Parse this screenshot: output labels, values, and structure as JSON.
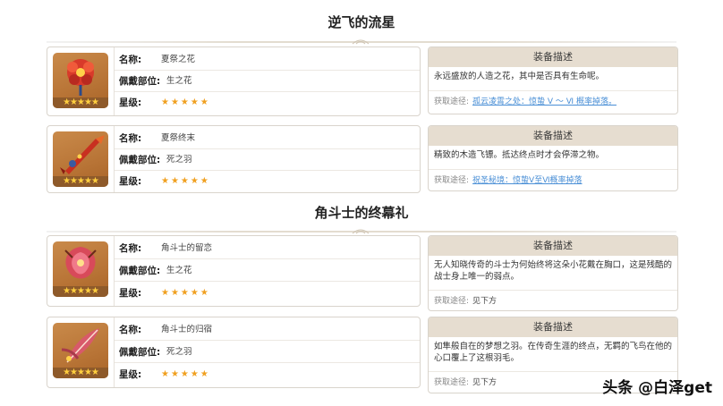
{
  "sets": [
    {
      "title": "逆飞的流星",
      "items": [
        {
          "name_label": "名称:",
          "name": "夏祭之花",
          "slot_label": "佩戴部位:",
          "slot": "生之花",
          "rarity_label": "星级:",
          "rarity": 5,
          "thumb_rarity": 5,
          "desc_header": "装备描述",
          "desc": "永远盛放的人造之花，其中是否具有生命呢。",
          "source_label": "获取途径:",
          "source": "孤云凌霄之处：惊蛰 Ⅴ ～ Ⅵ 概率掉落。",
          "source_is_link": true,
          "icon": "flower-icon"
        },
        {
          "name_label": "名称:",
          "name": "夏祭终末",
          "slot_label": "佩戴部位:",
          "slot": "死之羽",
          "rarity_label": "星级:",
          "rarity": 5,
          "thumb_rarity": 5,
          "desc_header": "装备描述",
          "desc": "精致的木造飞镖。抵达终点时才会停滞之物。",
          "source_label": "获取途径:",
          "source": "祝圣秘境：惊蛰Ⅴ至Ⅵ概率掉落",
          "source_is_link": true,
          "icon": "dart-icon"
        }
      ]
    },
    {
      "title": "角斗士的终幕礼",
      "items": [
        {
          "name_label": "名称:",
          "name": "角斗士的留恋",
          "slot_label": "佩戴部位:",
          "slot": "生之花",
          "rarity_label": "星级:",
          "rarity": 5,
          "thumb_rarity": 5,
          "desc_header": "装备描述",
          "desc": "无人知晓传奇的斗士为何始终将这朵小花戴在胸口，这是残酷的战士身上唯一的弱点。",
          "source_label": "获取途径:",
          "source": "见下方",
          "source_is_link": false,
          "icon": "flower-icon"
        },
        {
          "name_label": "名称:",
          "name": "角斗士的归宿",
          "slot_label": "佩戴部位:",
          "slot": "死之羽",
          "rarity_label": "星级:",
          "rarity": 5,
          "thumb_rarity": 5,
          "desc_header": "装备描述",
          "desc": "如隼般自在的梦想之羽。在传奇生涯的终点，无羁的飞鸟在他的心口覆上了这根羽毛。",
          "source_label": "获取途径:",
          "source": "见下方",
          "source_is_link": false,
          "icon": "feather-icon"
        }
      ]
    }
  ],
  "watermark": "头条 @白泽get",
  "colors": {
    "header_bg": "#e6ddd0",
    "link": "#4a8fd6",
    "star": "#f0a020",
    "thumb_bg": "#b87436"
  }
}
